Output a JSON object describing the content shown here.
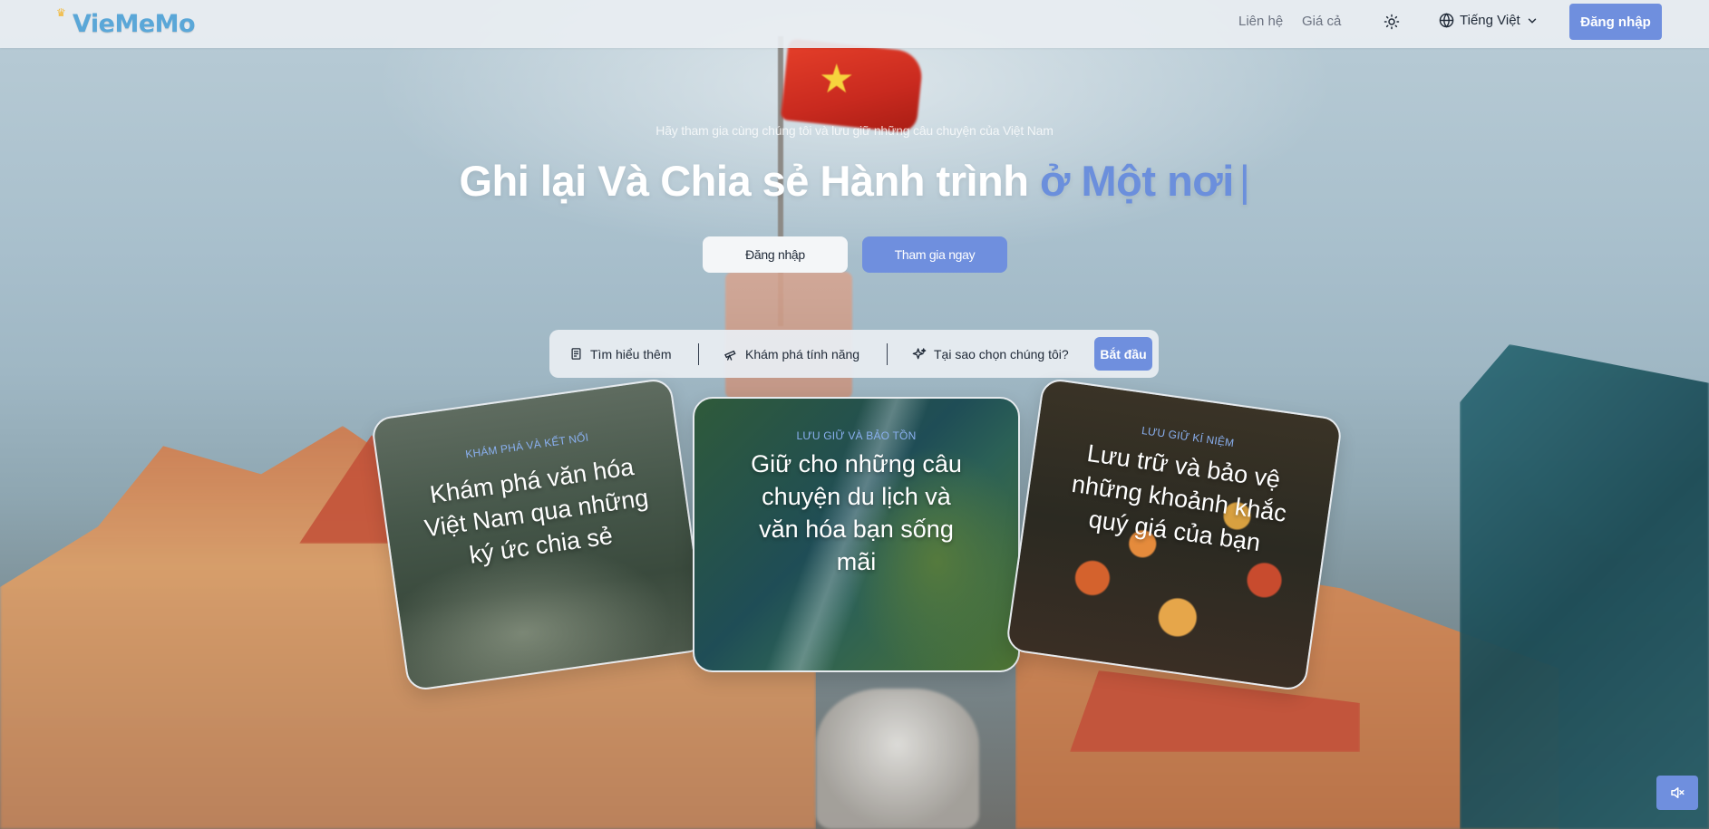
{
  "brand": {
    "name": "VieMeMo"
  },
  "nav": {
    "links": [
      "Liên hệ",
      "Giá cả"
    ],
    "language": "Tiếng Việt",
    "login_label": "Đăng nhập"
  },
  "hero": {
    "tagline": "Hãy tham gia cùng chúng tôi và lưu giữ những câu chuyện của Việt Nam",
    "headline_main": "Ghi lại Và Chia sẻ Hành trình",
    "headline_accent": "ở Một nơi",
    "caret": "|",
    "login_button": "Đăng nhập",
    "join_button": "Tham gia ngay"
  },
  "featurebar": {
    "items": [
      {
        "label": "Tìm hiểu thêm",
        "icon": "book-icon"
      },
      {
        "label": "Khám phá tính năng",
        "icon": "telescope-icon"
      },
      {
        "label": "Tại sao chọn chúng tôi?",
        "icon": "sparkles-icon"
      }
    ],
    "start_label": "Bắt đầu"
  },
  "cards": [
    {
      "label": "KHÁM PHÁ VÀ KẾT NỐI",
      "title": "Khám phá văn hóa Việt Nam qua những ký ức chia sẻ"
    },
    {
      "label": "LƯU GIỮ VÀ BẢO TỒN",
      "title": "Giữ cho những câu chuyện du lịch và văn hóa bạn sống mãi"
    },
    {
      "label": "LƯU GIỮ KÍ NIỆM",
      "title": "Lưu trữ và bảo vệ những khoảnh khắc quý giá của bạn"
    }
  ],
  "colors": {
    "accent": "#6f8fde",
    "navbar_bg": "#e9eef2",
    "logo": "#5aa7d8"
  },
  "icons": {
    "theme": "sun-icon",
    "language": "globe-icon",
    "chevron": "chevron-down-icon",
    "mute": "speaker-mute-icon"
  }
}
